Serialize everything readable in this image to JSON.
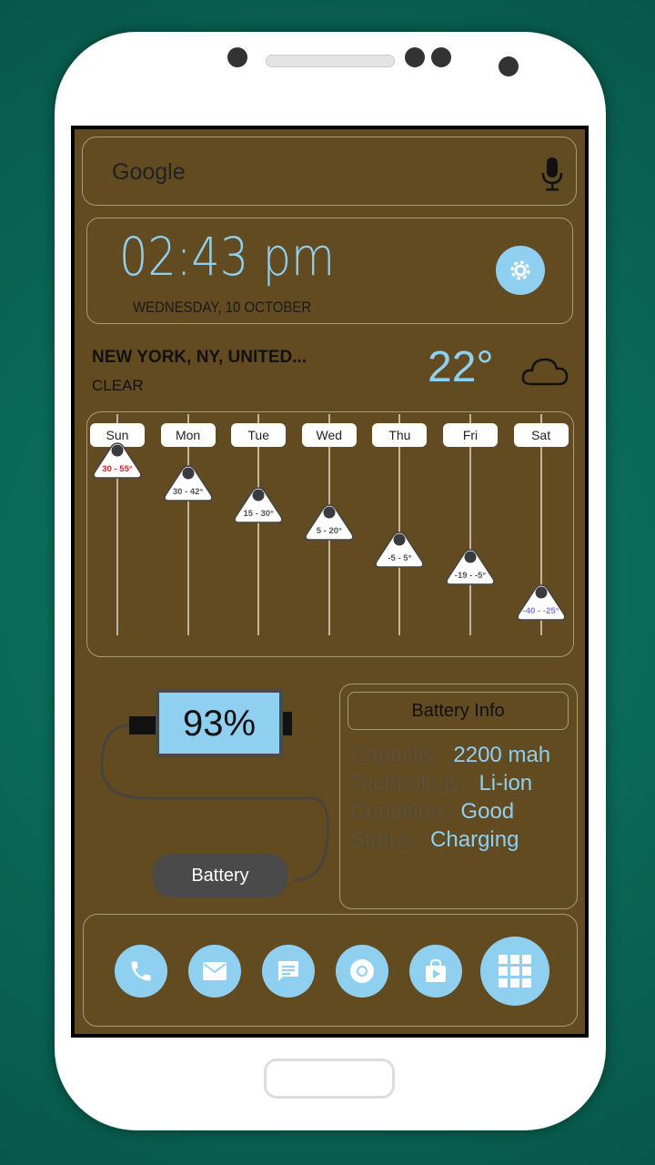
{
  "search": {
    "label": "Google",
    "icon": "mic-icon"
  },
  "clock": {
    "time": "02:43 pm",
    "date": "WEDNESDAY, 10 OCTOBER",
    "settings_icon": "gear-icon"
  },
  "weather": {
    "location": "NEW YORK, NY, UNITED...",
    "condition": "CLEAR",
    "temperature": "22°",
    "icon": "cloud-icon"
  },
  "forecast": [
    {
      "day": "Sun",
      "range": "30 - 55°",
      "low": 30,
      "high": 55,
      "color": "#d11f2a"
    },
    {
      "day": "Mon",
      "range": "30 - 42°",
      "low": 30,
      "high": 42,
      "color": "#555555"
    },
    {
      "day": "Tue",
      "range": "15 - 30°",
      "low": 15,
      "high": 30,
      "color": "#555555"
    },
    {
      "day": "Wed",
      "range": "5 - 20°",
      "low": 5,
      "high": 20,
      "color": "#555555"
    },
    {
      "day": "Thu",
      "range": "-5 - 5°",
      "low": -5,
      "high": 5,
      "color": "#555555"
    },
    {
      "day": "Fri",
      "range": "-19 - -5°",
      "low": -19,
      "high": -5,
      "color": "#555555"
    },
    {
      "day": "Sat",
      "range": "-40 - -25°",
      "low": -40,
      "high": -25,
      "color": "#8a7fd6"
    }
  ],
  "battery": {
    "percent": "93%",
    "level": 93,
    "button": "Battery",
    "info_title": "Battery Info",
    "rows": [
      {
        "label": "Capacity :",
        "value": "2200 mah"
      },
      {
        "label": "Technology :",
        "value": "Li-ion"
      },
      {
        "label": "Condition :",
        "value": "Good"
      },
      {
        "label": "Status :",
        "value": "Charging"
      }
    ]
  },
  "dock": [
    "phone-icon",
    "mail-icon",
    "messages-icon",
    "chrome-icon",
    "play-store-icon",
    "app-drawer-icon"
  ],
  "colors": {
    "accent": "#8fd0f0",
    "background": "#624a21"
  }
}
